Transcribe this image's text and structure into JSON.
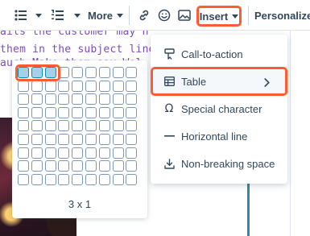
{
  "toolbar": {
    "bullet_list_icon": "bulleted-list-icon",
    "numbered_list_icon": "numbered-list-icon",
    "more_label": "More",
    "link_icon": "link-icon",
    "emoji_icon": "emoji-icon",
    "image_icon": "image-icon",
    "insert_label": "Insert",
    "personalize_label": "Personalize"
  },
  "editor": {
    "lines": [
      "ails the customer may n",
      "them in the subject line",
      "auch Make them say Wol"
    ]
  },
  "table_picker": {
    "columns": 9,
    "rows": 9,
    "selected_columns": 3,
    "selected_rows": 1,
    "size_label": "3 x 1"
  },
  "insert_menu": {
    "items": [
      {
        "label": "Call-to-action",
        "icon": "call-to-action-icon"
      },
      {
        "label": "Table",
        "icon": "table-icon",
        "has_submenu": true,
        "active": true
      },
      {
        "label": "Special character",
        "icon": "omega-icon"
      },
      {
        "label": "Horizontal line",
        "icon": "horizontal-line-icon"
      },
      {
        "label": "Non-breaking space",
        "icon": "non-breaking-space-icon"
      }
    ]
  },
  "colors": {
    "highlight": "#ff5c35",
    "selected_cell": "#a5d0ec",
    "text": "#33475b",
    "code_text": "#7c4dbd"
  }
}
